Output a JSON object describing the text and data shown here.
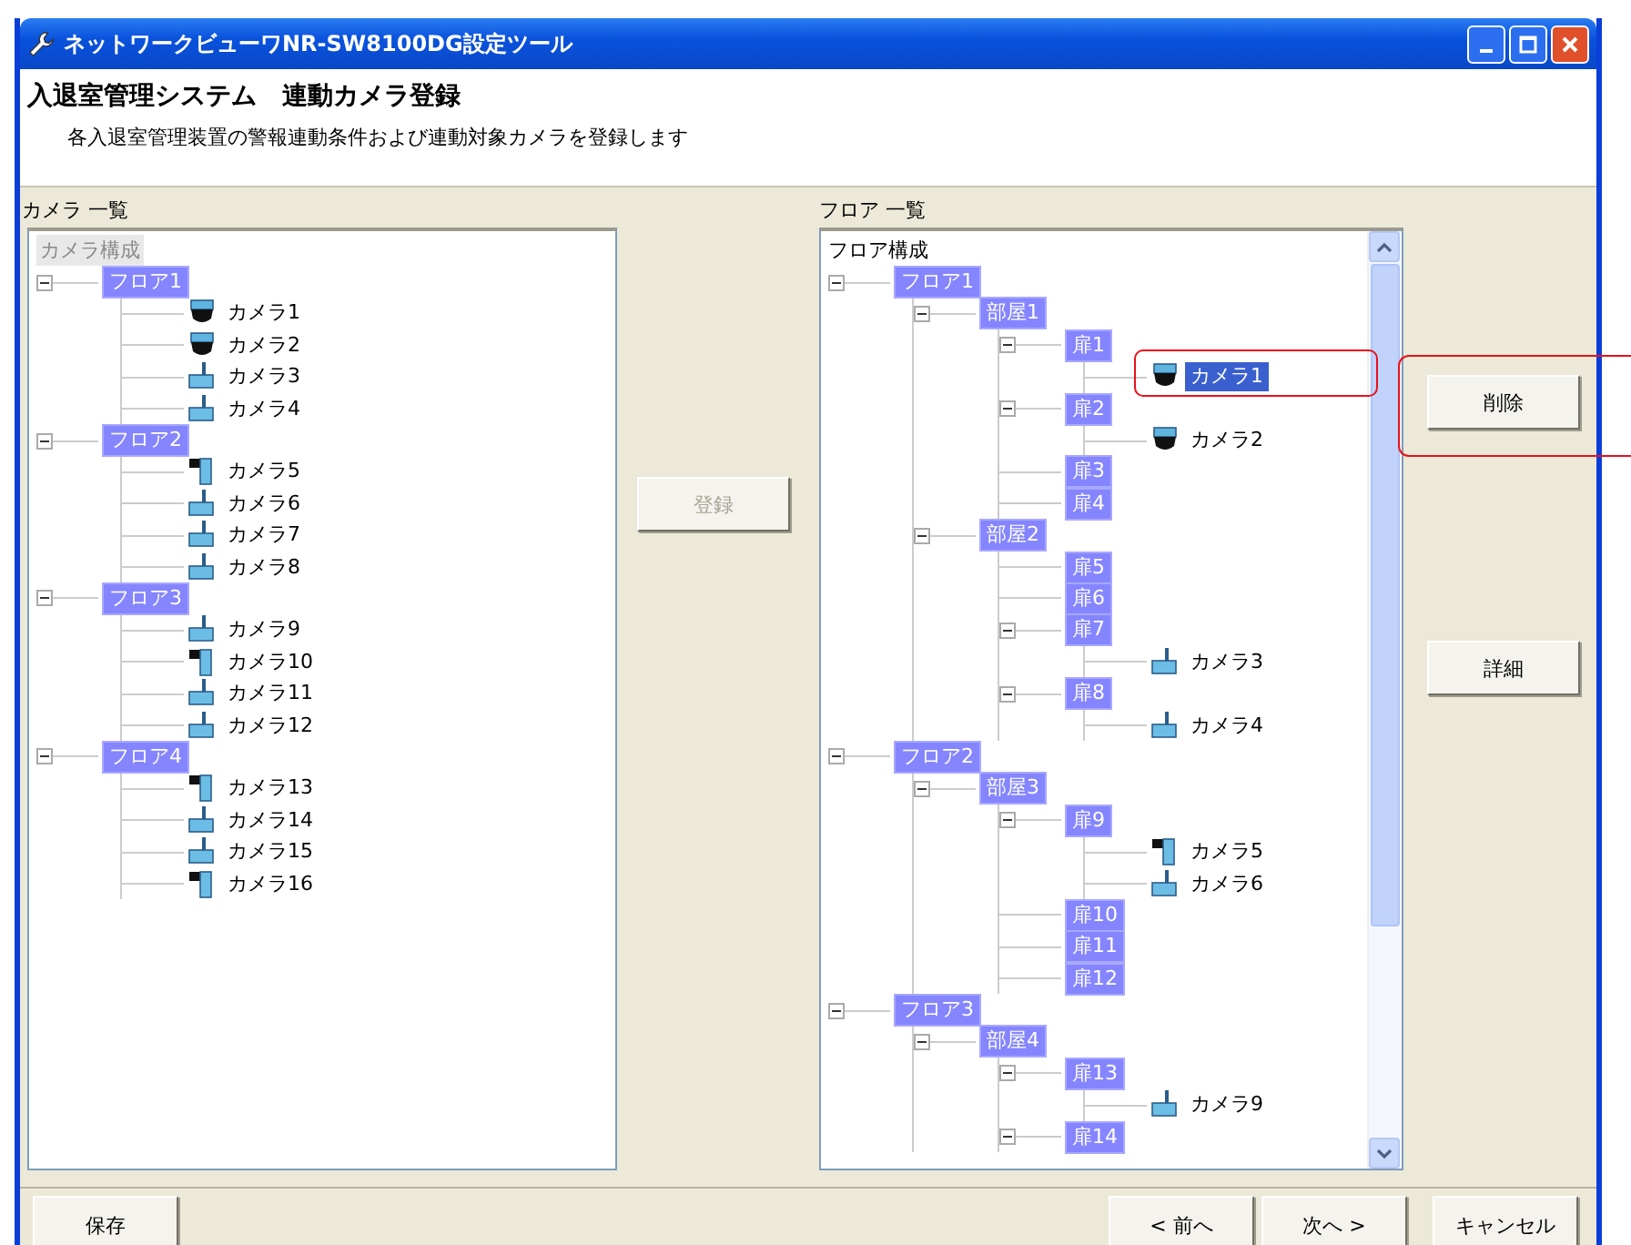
{
  "window": {
    "title": "ネットワークビューワNR-SW8100DG設定ツール"
  },
  "header": {
    "title": "入退室管理システム　連動カメラ登録",
    "description": "各入退室管理装置の警報連動条件および連動対象カメラを登録します"
  },
  "camera_panel": {
    "label": "カメラ 一覧",
    "root": "カメラ構成",
    "tree": [
      {
        "label": "フロア1",
        "kind": "group",
        "expanded": true,
        "children": [
          {
            "label": "カメラ1",
            "kind": "dome",
            "selected": false
          },
          {
            "label": "カメラ2",
            "kind": "dome",
            "selected": false
          },
          {
            "label": "カメラ3",
            "kind": "pole",
            "selected": false
          },
          {
            "label": "カメラ4",
            "kind": "pole",
            "selected": false
          }
        ]
      },
      {
        "label": "フロア2",
        "kind": "group",
        "expanded": true,
        "children": [
          {
            "label": "カメラ5",
            "kind": "wall",
            "selected": false
          },
          {
            "label": "カメラ6",
            "kind": "pole",
            "selected": false
          },
          {
            "label": "カメラ7",
            "kind": "pole",
            "selected": false
          },
          {
            "label": "カメラ8",
            "kind": "pole",
            "selected": false
          }
        ]
      },
      {
        "label": "フロア3",
        "kind": "group",
        "expanded": true,
        "children": [
          {
            "label": "カメラ9",
            "kind": "pole",
            "selected": false
          },
          {
            "label": "カメラ10",
            "kind": "wall",
            "selected": false
          },
          {
            "label": "カメラ11",
            "kind": "pole",
            "selected": false
          },
          {
            "label": "カメラ12",
            "kind": "pole",
            "selected": false
          }
        ]
      },
      {
        "label": "フロア4",
        "kind": "group",
        "expanded": true,
        "children": [
          {
            "label": "カメラ13",
            "kind": "wall",
            "selected": false
          },
          {
            "label": "カメラ14",
            "kind": "pole",
            "selected": false
          },
          {
            "label": "カメラ15",
            "kind": "pole",
            "selected": false
          },
          {
            "label": "カメラ16",
            "kind": "wall",
            "selected": false
          }
        ]
      }
    ]
  },
  "register_button": {
    "label": "登録",
    "disabled": true
  },
  "floor_panel": {
    "label": "フロア 一覧",
    "root": "フロア構成",
    "tree": [
      {
        "label": "フロア1",
        "kind": "group",
        "expanded": true,
        "children": [
          {
            "label": "部屋1",
            "kind": "group",
            "expanded": true,
            "children": [
              {
                "label": "扉1",
                "kind": "group",
                "expanded": true,
                "children": [
                  {
                    "label": "カメラ1",
                    "kind": "dome",
                    "selected": true
                  }
                ]
              },
              {
                "label": "扉2",
                "kind": "group",
                "expanded": true,
                "children": [
                  {
                    "label": "カメラ2",
                    "kind": "dome",
                    "selected": false
                  }
                ]
              },
              {
                "label": "扉3",
                "kind": "group"
              },
              {
                "label": "扉4",
                "kind": "group"
              }
            ]
          },
          {
            "label": "部屋2",
            "kind": "group",
            "expanded": true,
            "children": [
              {
                "label": "扉5",
                "kind": "group"
              },
              {
                "label": "扉6",
                "kind": "group"
              },
              {
                "label": "扉7",
                "kind": "group",
                "expanded": true,
                "children": [
                  {
                    "label": "カメラ3",
                    "kind": "pole",
                    "selected": false
                  }
                ]
              },
              {
                "label": "扉8",
                "kind": "group",
                "expanded": true,
                "children": [
                  {
                    "label": "カメラ4",
                    "kind": "pole",
                    "selected": false
                  }
                ]
              }
            ]
          }
        ]
      },
      {
        "label": "フロア2",
        "kind": "group",
        "expanded": true,
        "children": [
          {
            "label": "部屋3",
            "kind": "group",
            "expanded": true,
            "children": [
              {
                "label": "扉9",
                "kind": "group",
                "expanded": true,
                "children": [
                  {
                    "label": "カメラ5",
                    "kind": "wall",
                    "selected": false
                  },
                  {
                    "label": "カメラ6",
                    "kind": "pole",
                    "selected": false
                  }
                ]
              },
              {
                "label": "扉10",
                "kind": "group"
              },
              {
                "label": "扉11",
                "kind": "group"
              },
              {
                "label": "扉12",
                "kind": "group"
              }
            ]
          }
        ]
      },
      {
        "label": "フロア3",
        "kind": "group",
        "expanded": true,
        "children": [
          {
            "label": "部屋4",
            "kind": "group",
            "expanded": true,
            "children": [
              {
                "label": "扉13",
                "kind": "group",
                "expanded": true,
                "children": [
                  {
                    "label": "カメラ9",
                    "kind": "pole",
                    "selected": false
                  }
                ]
              },
              {
                "label": "扉14",
                "kind": "group",
                "expanded": true
              }
            ]
          }
        ]
      }
    ]
  },
  "side_buttons": [
    {
      "label": "削除"
    },
    {
      "label": "詳細"
    }
  ],
  "footer": {
    "save": "保存",
    "nav": [
      "< 前へ",
      "次へ >",
      "キャンセル"
    ]
  }
}
